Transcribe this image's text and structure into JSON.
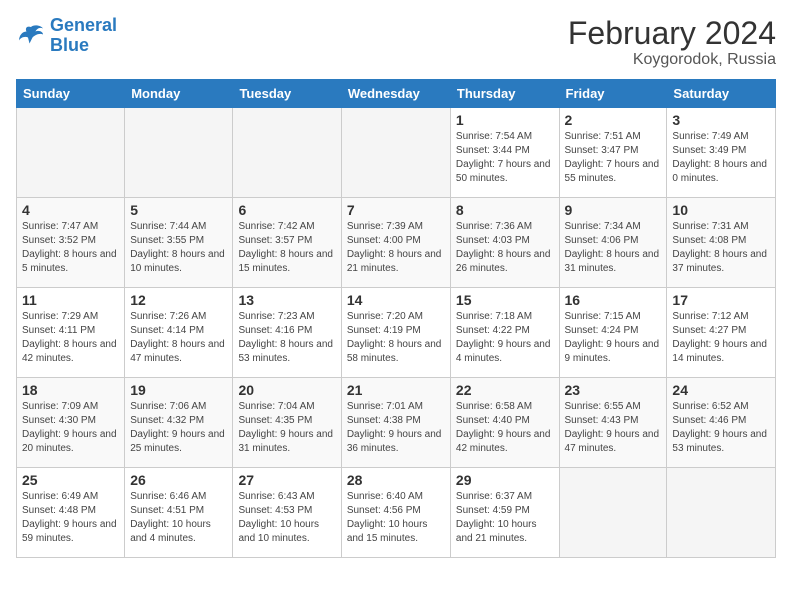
{
  "header": {
    "logo_line1": "General",
    "logo_line2": "Blue",
    "title": "February 2024",
    "subtitle": "Koygorodok, Russia"
  },
  "days_of_week": [
    "Sunday",
    "Monday",
    "Tuesday",
    "Wednesday",
    "Thursday",
    "Friday",
    "Saturday"
  ],
  "weeks": [
    [
      {
        "day": "",
        "sunrise": "",
        "sunset": "",
        "daylight": ""
      },
      {
        "day": "",
        "sunrise": "",
        "sunset": "",
        "daylight": ""
      },
      {
        "day": "",
        "sunrise": "",
        "sunset": "",
        "daylight": ""
      },
      {
        "day": "",
        "sunrise": "",
        "sunset": "",
        "daylight": ""
      },
      {
        "day": "1",
        "sunrise": "7:54 AM",
        "sunset": "3:44 PM",
        "daylight": "7 hours and 50 minutes."
      },
      {
        "day": "2",
        "sunrise": "7:51 AM",
        "sunset": "3:47 PM",
        "daylight": "7 hours and 55 minutes."
      },
      {
        "day": "3",
        "sunrise": "7:49 AM",
        "sunset": "3:49 PM",
        "daylight": "8 hours and 0 minutes."
      }
    ],
    [
      {
        "day": "4",
        "sunrise": "7:47 AM",
        "sunset": "3:52 PM",
        "daylight": "8 hours and 5 minutes."
      },
      {
        "day": "5",
        "sunrise": "7:44 AM",
        "sunset": "3:55 PM",
        "daylight": "8 hours and 10 minutes."
      },
      {
        "day": "6",
        "sunrise": "7:42 AM",
        "sunset": "3:57 PM",
        "daylight": "8 hours and 15 minutes."
      },
      {
        "day": "7",
        "sunrise": "7:39 AM",
        "sunset": "4:00 PM",
        "daylight": "8 hours and 21 minutes."
      },
      {
        "day": "8",
        "sunrise": "7:36 AM",
        "sunset": "4:03 PM",
        "daylight": "8 hours and 26 minutes."
      },
      {
        "day": "9",
        "sunrise": "7:34 AM",
        "sunset": "4:06 PM",
        "daylight": "8 hours and 31 minutes."
      },
      {
        "day": "10",
        "sunrise": "7:31 AM",
        "sunset": "4:08 PM",
        "daylight": "8 hours and 37 minutes."
      }
    ],
    [
      {
        "day": "11",
        "sunrise": "7:29 AM",
        "sunset": "4:11 PM",
        "daylight": "8 hours and 42 minutes."
      },
      {
        "day": "12",
        "sunrise": "7:26 AM",
        "sunset": "4:14 PM",
        "daylight": "8 hours and 47 minutes."
      },
      {
        "day": "13",
        "sunrise": "7:23 AM",
        "sunset": "4:16 PM",
        "daylight": "8 hours and 53 minutes."
      },
      {
        "day": "14",
        "sunrise": "7:20 AM",
        "sunset": "4:19 PM",
        "daylight": "8 hours and 58 minutes."
      },
      {
        "day": "15",
        "sunrise": "7:18 AM",
        "sunset": "4:22 PM",
        "daylight": "9 hours and 4 minutes."
      },
      {
        "day": "16",
        "sunrise": "7:15 AM",
        "sunset": "4:24 PM",
        "daylight": "9 hours and 9 minutes."
      },
      {
        "day": "17",
        "sunrise": "7:12 AM",
        "sunset": "4:27 PM",
        "daylight": "9 hours and 14 minutes."
      }
    ],
    [
      {
        "day": "18",
        "sunrise": "7:09 AM",
        "sunset": "4:30 PM",
        "daylight": "9 hours and 20 minutes."
      },
      {
        "day": "19",
        "sunrise": "7:06 AM",
        "sunset": "4:32 PM",
        "daylight": "9 hours and 25 minutes."
      },
      {
        "day": "20",
        "sunrise": "7:04 AM",
        "sunset": "4:35 PM",
        "daylight": "9 hours and 31 minutes."
      },
      {
        "day": "21",
        "sunrise": "7:01 AM",
        "sunset": "4:38 PM",
        "daylight": "9 hours and 36 minutes."
      },
      {
        "day": "22",
        "sunrise": "6:58 AM",
        "sunset": "4:40 PM",
        "daylight": "9 hours and 42 minutes."
      },
      {
        "day": "23",
        "sunrise": "6:55 AM",
        "sunset": "4:43 PM",
        "daylight": "9 hours and 47 minutes."
      },
      {
        "day": "24",
        "sunrise": "6:52 AM",
        "sunset": "4:46 PM",
        "daylight": "9 hours and 53 minutes."
      }
    ],
    [
      {
        "day": "25",
        "sunrise": "6:49 AM",
        "sunset": "4:48 PM",
        "daylight": "9 hours and 59 minutes."
      },
      {
        "day": "26",
        "sunrise": "6:46 AM",
        "sunset": "4:51 PM",
        "daylight": "10 hours and 4 minutes."
      },
      {
        "day": "27",
        "sunrise": "6:43 AM",
        "sunset": "4:53 PM",
        "daylight": "10 hours and 10 minutes."
      },
      {
        "day": "28",
        "sunrise": "6:40 AM",
        "sunset": "4:56 PM",
        "daylight": "10 hours and 15 minutes."
      },
      {
        "day": "29",
        "sunrise": "6:37 AM",
        "sunset": "4:59 PM",
        "daylight": "10 hours and 21 minutes."
      },
      {
        "day": "",
        "sunrise": "",
        "sunset": "",
        "daylight": ""
      },
      {
        "day": "",
        "sunrise": "",
        "sunset": "",
        "daylight": ""
      }
    ]
  ]
}
